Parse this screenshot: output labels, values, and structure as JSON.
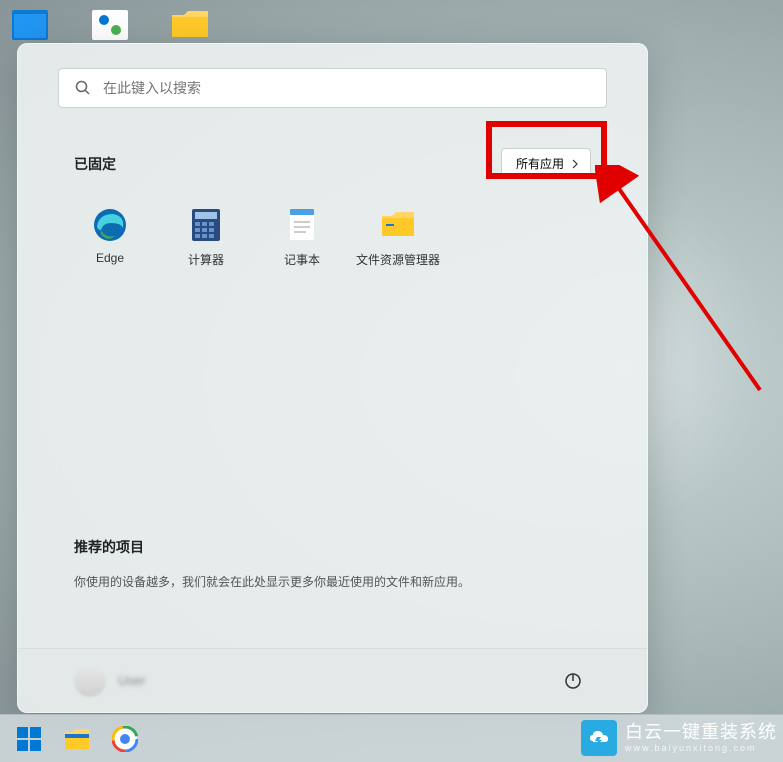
{
  "search": {
    "placeholder": "在此键入以搜索"
  },
  "pinned": {
    "title": "已固定",
    "all_apps_label": "所有应用",
    "items": [
      {
        "label": "Edge"
      },
      {
        "label": "计算器"
      },
      {
        "label": "记事本"
      },
      {
        "label": "文件资源管理器"
      }
    ]
  },
  "recommended": {
    "title": "推荐的项目",
    "text": "你使用的设备越多，我们就会在此处显示更多你最近使用的文件和新应用。"
  },
  "user": {
    "name": "User"
  },
  "watermark": {
    "main": "白云一键重装系统",
    "sub": "www.baiyunxitong.com"
  }
}
